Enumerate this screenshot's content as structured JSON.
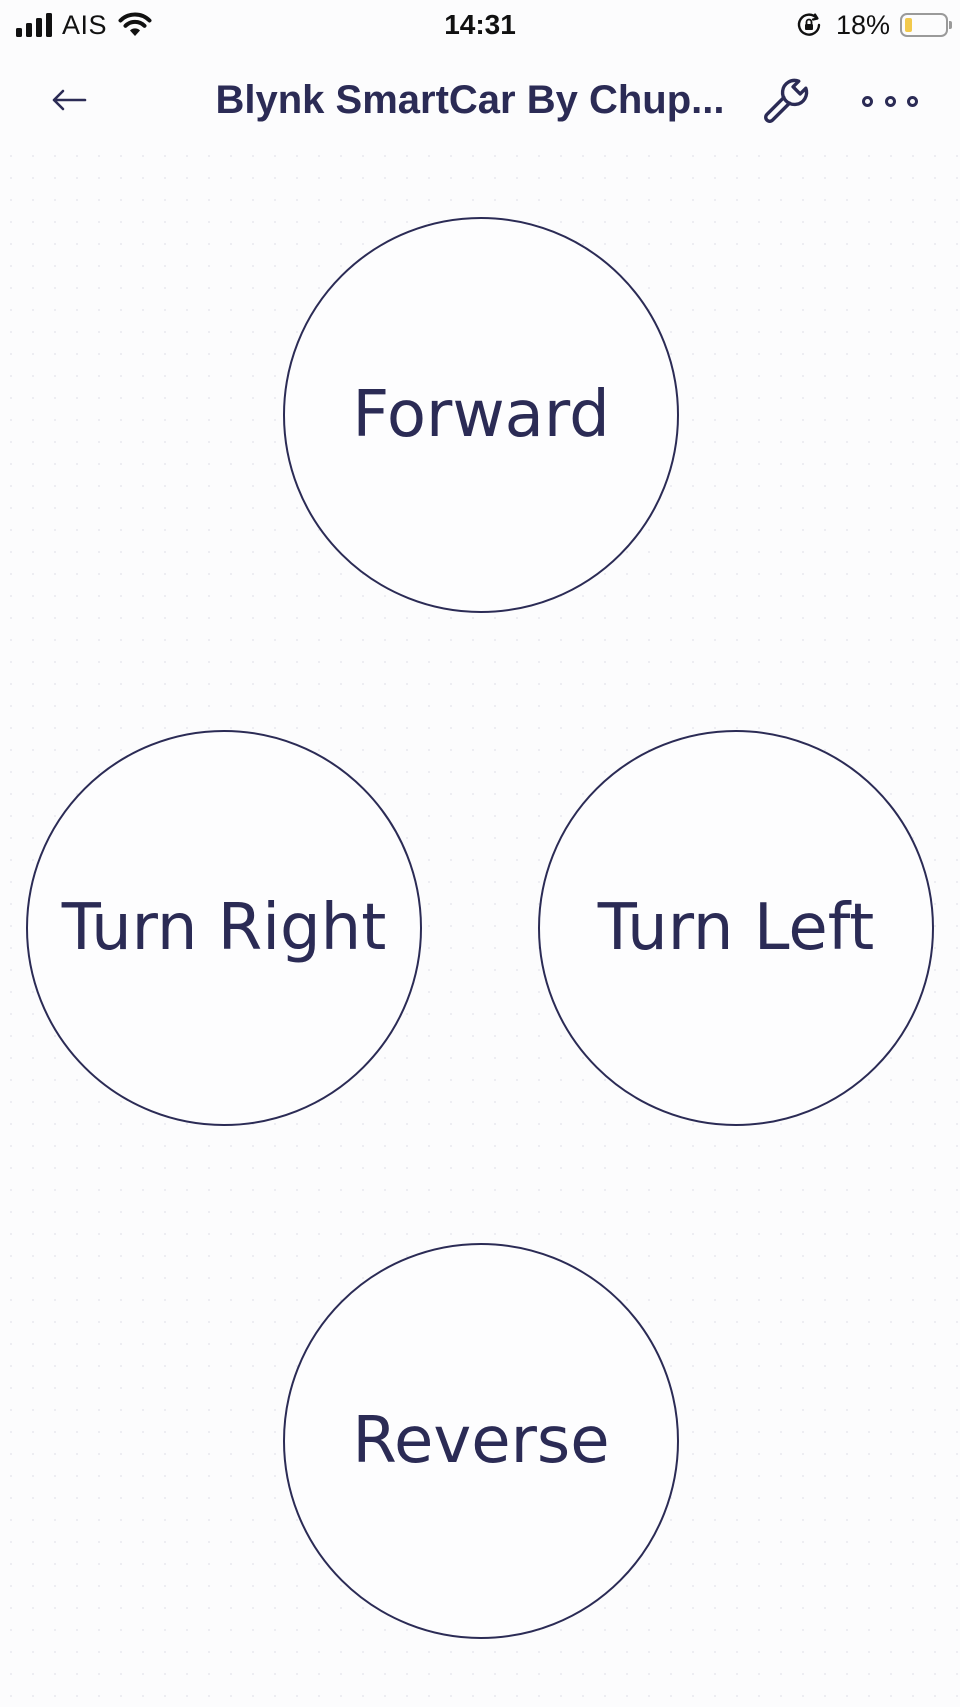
{
  "status_bar": {
    "carrier": "AIS",
    "time": "14:31",
    "battery_percent": "18%",
    "battery_level": 0.18,
    "signal_bars": 4,
    "icons": [
      "signal-icon",
      "wifi-icon",
      "orientation-lock-icon",
      "battery-icon"
    ]
  },
  "nav": {
    "title": "Blynk SmartCar By Chup...",
    "icons": {
      "back": "back-arrow-icon",
      "settings": "wrench-icon",
      "more": "more-icon"
    }
  },
  "controls": {
    "forward_label": "Forward",
    "turn_right_label": "Turn Right",
    "turn_left_label": "Turn Left",
    "reverse_label": "Reverse"
  },
  "colors": {
    "accent": "#2b2b55",
    "background": "#fcfcfd",
    "battery_fill": "#f2c94c"
  }
}
